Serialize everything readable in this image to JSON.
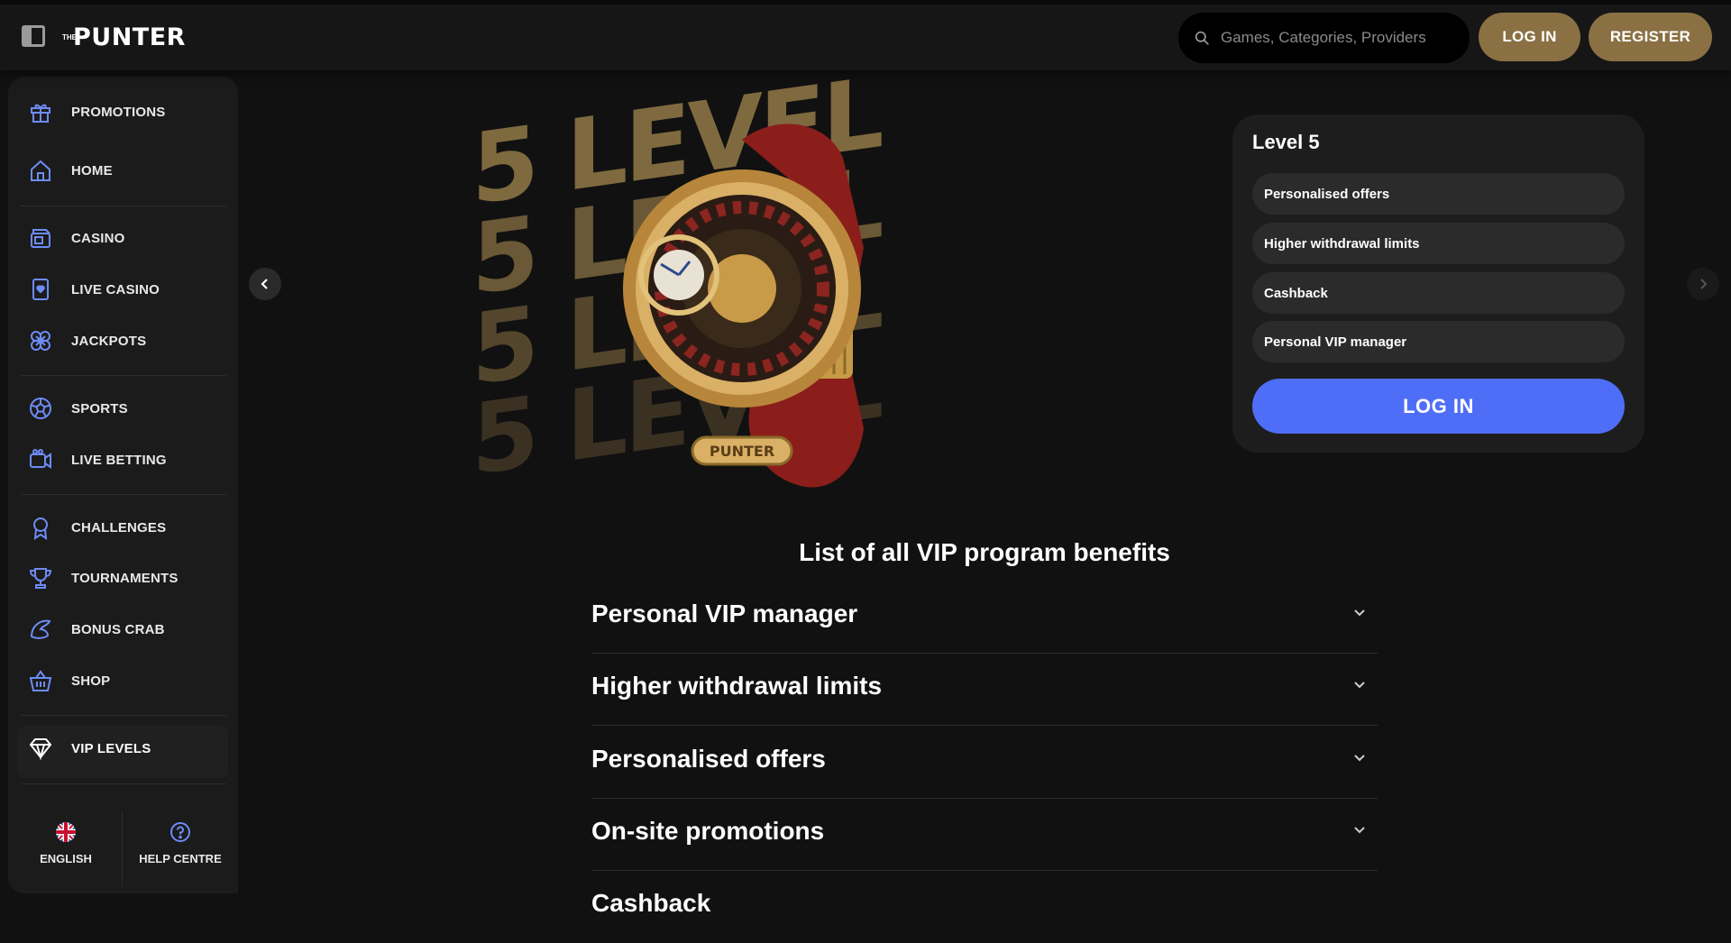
{
  "header": {
    "logo_small": "THE",
    "logo_main": "PUNTER",
    "search_placeholder": "Games, Categories, Providers",
    "login_label": "LOG IN",
    "register_label": "REGISTER"
  },
  "sidebar": {
    "items": [
      {
        "label": "PROMOTIONS",
        "icon": "gift-icon"
      },
      {
        "label": "HOME",
        "icon": "home-icon"
      },
      {
        "label": "CASINO",
        "icon": "casino-icon"
      },
      {
        "label": "LIVE CASINO",
        "icon": "card-icon"
      },
      {
        "label": "JACKPOTS",
        "icon": "clover-icon"
      },
      {
        "label": "SPORTS",
        "icon": "ball-icon"
      },
      {
        "label": "LIVE BETTING",
        "icon": "video-icon"
      },
      {
        "label": "CHALLENGES",
        "icon": "award-icon"
      },
      {
        "label": "TOURNAMENTS",
        "icon": "trophy-icon"
      },
      {
        "label": "BONUS CRAB",
        "icon": "crab-icon"
      },
      {
        "label": "SHOP",
        "icon": "basket-icon"
      },
      {
        "label": "VIP LEVELS",
        "icon": "diamond-icon"
      }
    ],
    "footer": {
      "language_label": "ENGLISH",
      "help_label": "HELP CENTRE"
    }
  },
  "hero": {
    "watermark_text": "5 LEVEL",
    "watch_brand": "PUNTER"
  },
  "level_card": {
    "title": "Level 5",
    "benefits": [
      "Personalised offers",
      "Higher withdrawal limits",
      "Cashback",
      "Personal VIP manager"
    ],
    "login_label": "LOG IN"
  },
  "benefits_section": {
    "title": "List of all VIP program benefits",
    "items": [
      "Personal VIP manager",
      "Higher withdrawal limits",
      "Personalised offers",
      "On-site promotions",
      "Cashback"
    ]
  },
  "colors": {
    "accent_gold": "#8a7043",
    "accent_blue": "#4f6ef7",
    "icon_blue": "#6d8cf5",
    "background": "#111111"
  }
}
